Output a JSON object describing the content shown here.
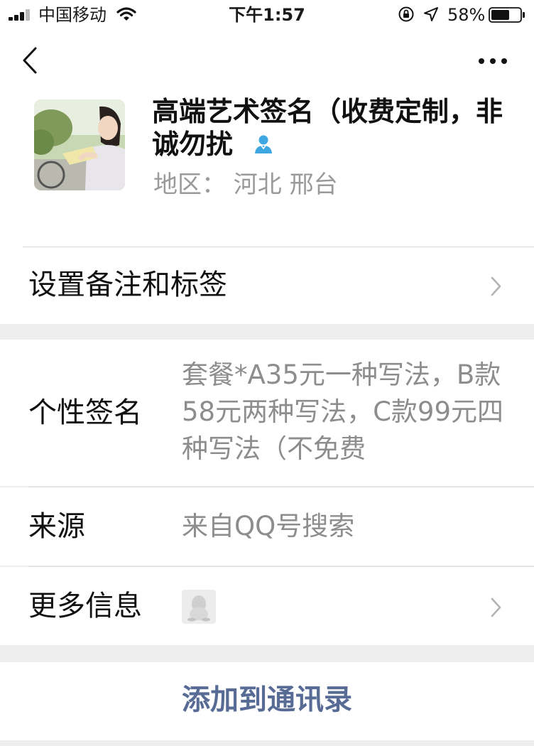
{
  "status_bar": {
    "carrier": "中国移动",
    "time": "下午1:57",
    "battery": "58%"
  },
  "profile": {
    "name": "高端艺术签名（收费定制，非诚勿扰",
    "region": "地区：  河北  邢台",
    "gender_icon": "female-icon",
    "gender_color": "#3ea6e0"
  },
  "rows": {
    "remark_label": "设置备注和标签",
    "signature_label": "个性签名",
    "signature_value": "套餐*A35元一种写法，B款58元两种写法，C款99元四种写法（不免费",
    "source_label": "来源",
    "source_value": "来自QQ号搜索",
    "more_label": "更多信息"
  },
  "action": {
    "add_contact": "添加到通讯录",
    "link_color": "#576b95"
  }
}
